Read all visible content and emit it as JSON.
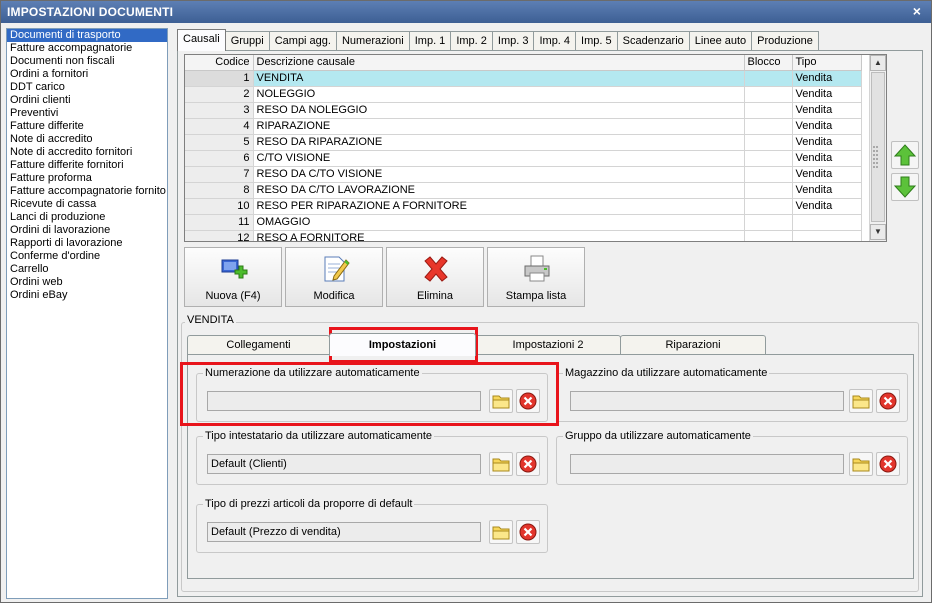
{
  "window": {
    "title": "IMPOSTAZIONI DOCUMENTI",
    "close_glyph": "×"
  },
  "left_list": {
    "items": [
      "Documenti di trasporto",
      "Fatture accompagnatorie",
      "Documenti non fiscali",
      "Ordini a fornitori",
      "DDT carico",
      "Ordini clienti",
      "Preventivi",
      "Fatture differite",
      "Note di accredito",
      "Note di accredito fornitori",
      "Fatture differite fornitori",
      "Fatture proforma",
      "Fatture accompagnatorie fornito",
      "Ricevute di cassa",
      "Lanci di produzione",
      "Ordini di lavorazione",
      "Rapporti di lavorazione",
      "Conferme d'ordine",
      "Carrello",
      "Ordini web",
      "Ordini eBay"
    ],
    "selected_index": 0
  },
  "top_tabs": [
    "Causali",
    "Gruppi",
    "Campi agg.",
    "Numerazioni",
    "Imp. 1",
    "Imp. 2",
    "Imp. 3",
    "Imp. 4",
    "Imp. 5",
    "Scadenzario",
    "Linee auto",
    "Produzione"
  ],
  "active_top_tab": 0,
  "grid": {
    "columns": [
      "Codice",
      "Descrizione causale",
      "Blocco",
      "Tipo"
    ],
    "rows": [
      {
        "code": "1",
        "desc": "VENDITA",
        "blocco": "",
        "tipo": "Vendita"
      },
      {
        "code": "2",
        "desc": "NOLEGGIO",
        "blocco": "",
        "tipo": "Vendita"
      },
      {
        "code": "3",
        "desc": "RESO DA NOLEGGIO",
        "blocco": "",
        "tipo": "Vendita"
      },
      {
        "code": "4",
        "desc": "RIPARAZIONE",
        "blocco": "",
        "tipo": "Vendita"
      },
      {
        "code": "5",
        "desc": "RESO DA RIPARAZIONE",
        "blocco": "",
        "tipo": "Vendita"
      },
      {
        "code": "6",
        "desc": "C/TO VISIONE",
        "blocco": "",
        "tipo": "Vendita"
      },
      {
        "code": "7",
        "desc": "RESO DA C/TO VISIONE",
        "blocco": "",
        "tipo": "Vendita"
      },
      {
        "code": "8",
        "desc": "RESO DA C/TO LAVORAZIONE",
        "blocco": "",
        "tipo": "Vendita"
      },
      {
        "code": "10",
        "desc": "RESO PER RIPARAZIONE A FORNITORE",
        "blocco": "",
        "tipo": "Vendita"
      },
      {
        "code": "11",
        "desc": "OMAGGIO",
        "blocco": "",
        "tipo": ""
      },
      {
        "code": "12",
        "desc": "RESO A FORNITORE",
        "blocco": "",
        "tipo": ""
      }
    ],
    "selected_index": 0
  },
  "actions": {
    "new": "Nuova (F4)",
    "edit": "Modifica",
    "delete": "Elimina",
    "print": "Stampa lista"
  },
  "section": {
    "title": "VENDITA",
    "tabs": [
      "Collegamenti",
      "Impostazioni",
      "Impostazioni 2",
      "Riparazioni"
    ],
    "active_tab": 1
  },
  "fields": {
    "numerazione": {
      "label": "Numerazione da utilizzare automaticamente",
      "value": ""
    },
    "magazzino": {
      "label": "Magazzino da utilizzare automaticamente",
      "value": ""
    },
    "intestatario": {
      "label": "Tipo intestatario da utilizzare automaticamente",
      "value": "Default (Clienti)"
    },
    "gruppo": {
      "label": "Gruppo da utilizzare automaticamente",
      "value": ""
    },
    "prezzi": {
      "label": "Tipo di prezzi articoli da proporre di default",
      "value": "Default (Prezzo di vendita)"
    }
  },
  "colors": {
    "title_bar": "#4a6ca3",
    "selection": "#316ac5",
    "row_highlight": "#b4e8f0",
    "annotation": "#e8141b"
  },
  "icons": {
    "new": "add-document-icon",
    "edit": "edit-document-icon",
    "delete": "delete-x-icon",
    "print": "printer-icon",
    "browse": "folder-icon",
    "clear": "clear-red-icon",
    "up": "arrow-up-icon",
    "down": "arrow-down-icon"
  }
}
